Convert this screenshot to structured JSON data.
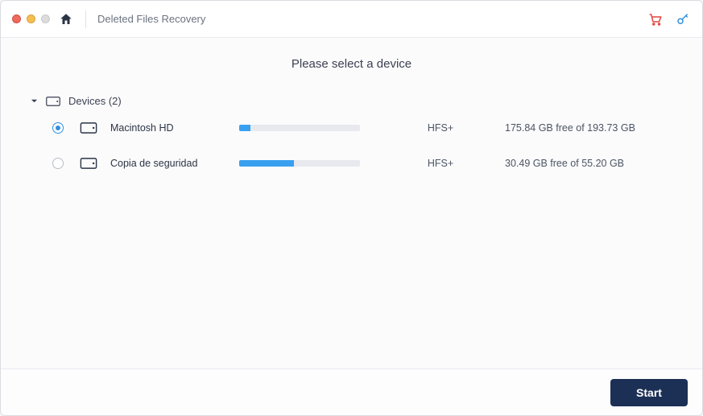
{
  "titlebar": {
    "title": "Deleted Files Recovery"
  },
  "main": {
    "heading": "Please select a device",
    "group_label": "Devices (2)"
  },
  "devices": [
    {
      "name": "Macintosh HD",
      "filesystem": "HFS+",
      "free_text": "175.84 GB free of 193.73 GB",
      "used_percent": 9,
      "selected": true
    },
    {
      "name": "Copia de seguridad",
      "filesystem": "HFS+",
      "free_text": "30.49 GB free of 55.20 GB",
      "used_percent": 45,
      "selected": false
    }
  ],
  "footer": {
    "start_label": "Start"
  },
  "colors": {
    "accent": "#2f8fe0",
    "primary_button": "#1c3055",
    "cart_icon": "#e1453e"
  }
}
